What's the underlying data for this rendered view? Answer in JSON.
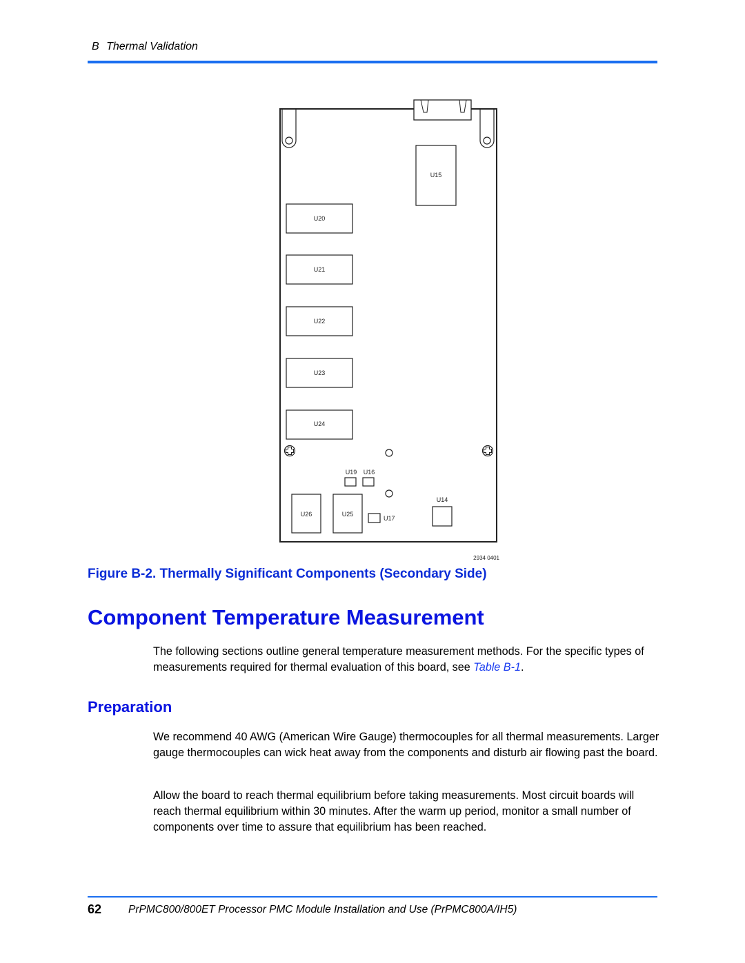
{
  "header": {
    "section_letter": "B",
    "section_title": "Thermal Validation"
  },
  "figure": {
    "caption": "Figure B-2. Thermally Significant Components (Secondary Side)",
    "drawing_number": "2934 0401",
    "components": {
      "u15": "U15",
      "u20": "U20",
      "u21": "U21",
      "u22": "U22",
      "u23": "U23",
      "u24": "U24",
      "u19": "U19",
      "u16": "U16",
      "u26": "U26",
      "u25": "U25",
      "u17": "U17",
      "u14": "U14"
    }
  },
  "section": {
    "title": "Component Temperature Measurement",
    "intro_text": "The following sections outline general temperature measurement methods. For the specific types of measurements required for thermal evaluation of this board, see ",
    "intro_link": "Table B-1",
    "intro_end": "."
  },
  "subsection": {
    "title": "Preparation",
    "paragraph1": "We recommend 40 AWG (American Wire Gauge) thermocouples for all thermal measurements. Larger gauge thermocouples can wick heat away from the components and disturb air flowing past the board.",
    "paragraph2": "Allow the board to reach thermal equilibrium before taking measurements. Most circuit boards will reach thermal equilibrium within 30 minutes. After the warm up period, monitor a small number of components over time to assure that equilibrium has been reached."
  },
  "footer": {
    "page_number": "62",
    "doc_title": "PrPMC800/800ET Processor PMC Module Installation and Use (PrPMC800A/IH5)"
  },
  "colors": {
    "heading_blue": "#0a14e0",
    "rule_blue": "#1a6ef0",
    "link_blue": "#1a3cf0"
  }
}
